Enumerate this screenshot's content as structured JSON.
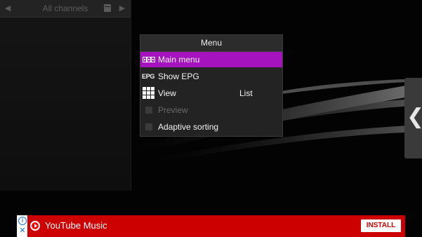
{
  "channel_panel": {
    "title": "All channels",
    "prev_icon": "triangle-left-icon",
    "next_icon": "triangle-right-icon",
    "calendar_icon": "calendar-icon"
  },
  "menu": {
    "title": "Menu",
    "items": [
      {
        "label": "Main menu",
        "icon": "main-menu-icon",
        "selected": true
      },
      {
        "label": "Show EPG",
        "icon": "epg-icon",
        "icon_text": "EPG"
      },
      {
        "label": "View",
        "icon": "grid-view-icon",
        "value": "List"
      },
      {
        "label": "Preview",
        "icon": "checkbox",
        "checked": false,
        "disabled": true
      },
      {
        "label": "Adaptive sorting",
        "icon": "checkbox",
        "checked": false
      }
    ]
  },
  "drawer": {
    "icon": "chevron-left-icon",
    "glyph": "❮"
  },
  "ad": {
    "info_glyph": "i",
    "close_glyph": "✕",
    "app_icon": "youtube-logo-icon",
    "title": "YouTube Music",
    "install_label": "INSTALL"
  },
  "colors": {
    "accent": "#a513be",
    "ad_background": "#cc0000",
    "menu_background": "#232323"
  }
}
